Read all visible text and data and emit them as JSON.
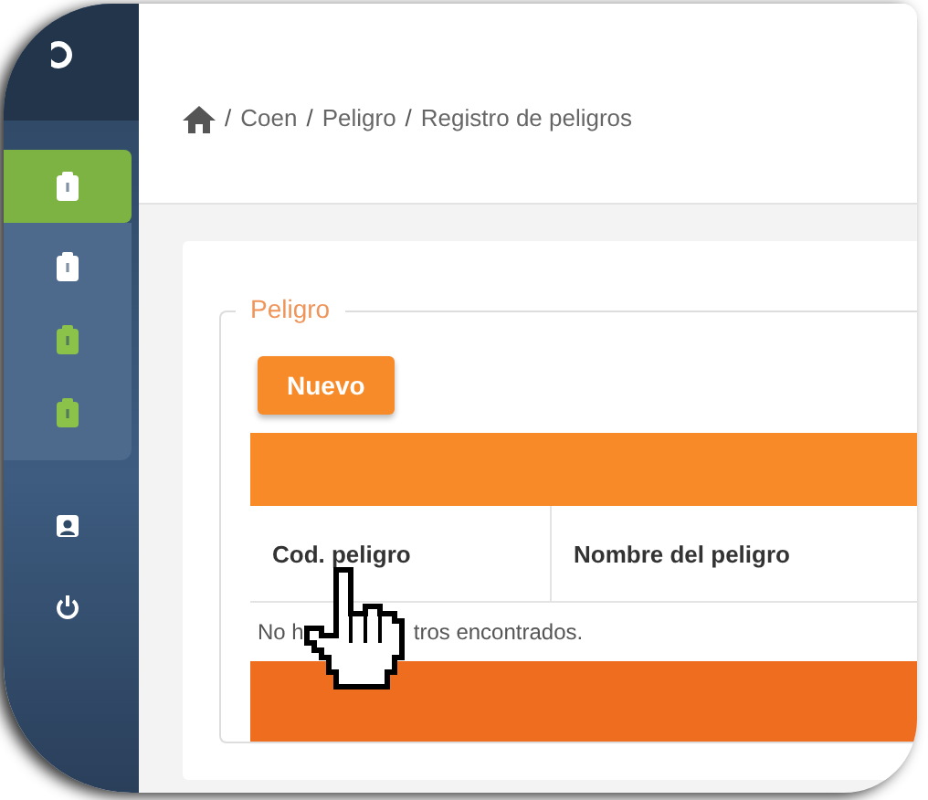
{
  "sidebar": {
    "items": [
      {
        "kind": "clipboard",
        "selected": true,
        "color": "#ffffff",
        "children": [
          {
            "kind": "clipboard",
            "selected": false,
            "color": "#ffffff"
          },
          {
            "kind": "clipboard",
            "selected": false,
            "color": "#8bc34a"
          },
          {
            "kind": "clipboard",
            "selected": false,
            "color": "#8bc34a"
          }
        ]
      },
      {
        "kind": "user",
        "selected": false
      },
      {
        "kind": "power",
        "selected": false
      }
    ]
  },
  "breadcrumb": {
    "separator": "/",
    "items": [
      "Coen",
      "Peligro",
      "Registro de peligros"
    ]
  },
  "panel": {
    "legend": "Peligro",
    "button": "Nuevo",
    "table": {
      "columns": [
        "Cod. peligro",
        "Nombre del peligro"
      ],
      "message_parts": [
        "No h",
        "tros encontrados."
      ]
    }
  }
}
